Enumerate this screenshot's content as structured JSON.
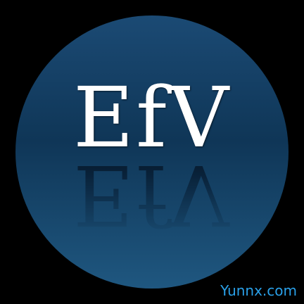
{
  "logo": {
    "text": "EfV"
  },
  "watermark": {
    "text": "Yunnx.com"
  },
  "colors": {
    "background": "#000000",
    "circle_top": "#1b4a74",
    "circle_middle": "#0f3657",
    "circle_bottom": "#1f5780",
    "logo_text": "#ffffff",
    "reflection": "#06182b",
    "watermark": "#2aa0e8"
  }
}
